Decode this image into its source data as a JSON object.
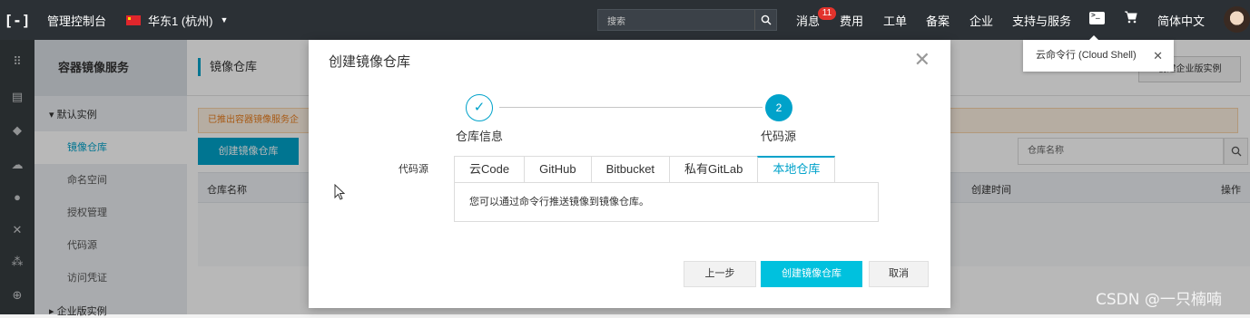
{
  "topbar": {
    "console_title": "管理控制台",
    "region": "华东1 (杭州)",
    "search_placeholder": "搜索",
    "nav": [
      "消息",
      "费用",
      "工单",
      "备案",
      "企业",
      "支持与服务"
    ],
    "message_badge": "11",
    "language": "简体中文"
  },
  "sidebar": {
    "service_title": "容器镜像服务",
    "group": "默认实例",
    "items": [
      "镜像仓库",
      "命名空间",
      "授权管理",
      "代码源",
      "访问凭证"
    ],
    "next_group": "企业版实例"
  },
  "main": {
    "breadcrumb": "镜像仓库",
    "notice": "已推出容器镜像服务企",
    "create_button": "创建镜像仓库",
    "search_placeholder": "仓库名称",
    "columns": [
      "仓库名称",
      "创建时间",
      "操作"
    ],
    "enterprise_button": "创建企业版实例"
  },
  "cloud_shell_tip": "云命令行 (Cloud Shell)",
  "dialog": {
    "title": "创建镜像仓库",
    "steps": [
      {
        "label": "仓库信息",
        "mark": "✓"
      },
      {
        "label": "代码源",
        "mark": "2"
      }
    ],
    "source_label": "代码源",
    "tabs": [
      "云Code",
      "GitHub",
      "Bitbucket",
      "私有GitLab",
      "本地仓库"
    ],
    "active_tab": "本地仓库",
    "panel_text": "您可以通过命令行推送镜像到镜像仓库。",
    "buttons": {
      "prev": "上一步",
      "create": "创建镜像仓库",
      "cancel": "取消"
    }
  },
  "watermark": "CSDN @一只楠喃",
  "colors": {
    "accent": "#00a2ca",
    "topbar": "#2b3035",
    "primary_button": "#00c1de"
  }
}
